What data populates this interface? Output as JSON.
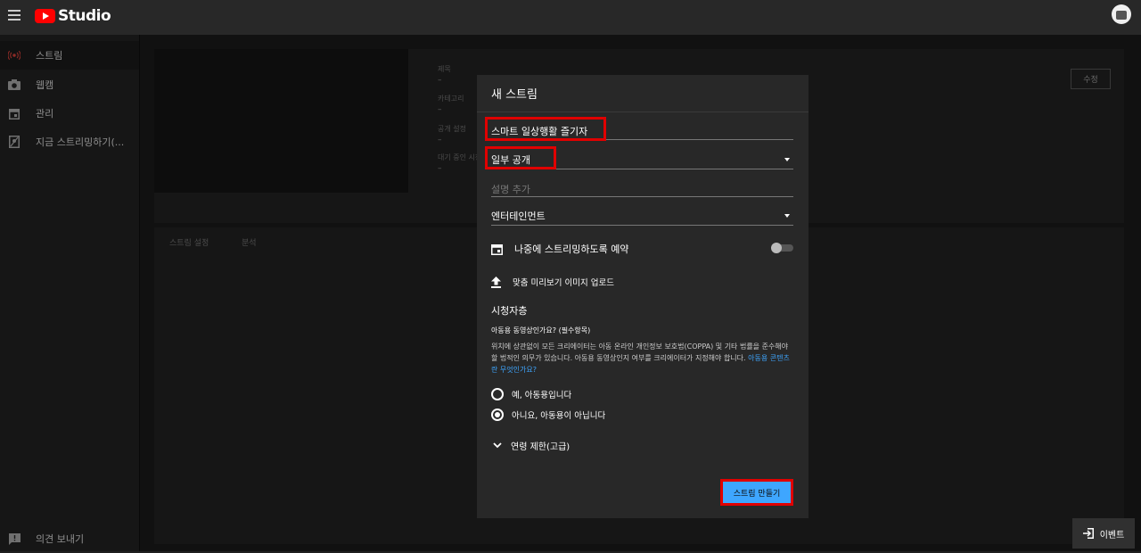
{
  "topbar": {
    "logo_text": "Studio",
    "menu_icon": "hamburger-menu-icon",
    "avatar_icon": "account-avatar-icon"
  },
  "sidebar": {
    "items": [
      {
        "label": "스트림",
        "icon": "live-stream-icon",
        "active": true
      },
      {
        "label": "웹캠",
        "icon": "camera-icon",
        "active": false
      },
      {
        "label": "관리",
        "icon": "calendar-icon",
        "active": false
      },
      {
        "label": "지금 스트리밍하기(...",
        "icon": "stream-now-icon",
        "active": false
      }
    ],
    "feedback_label": "의견 보내기",
    "feedback_icon": "feedback-icon"
  },
  "background": {
    "fields": [
      {
        "label": "제목",
        "value": "–"
      },
      {
        "label": "카테고리",
        "value": "–"
      },
      {
        "label": "공개 설정",
        "value": "–"
      },
      {
        "label": "대기 중인 시청자",
        "value": "–"
      }
    ],
    "edit_label": "수정",
    "tabs": [
      "스트림 설정",
      "분석"
    ]
  },
  "dialog": {
    "title": "새 스트림",
    "stream_title": "스마트 일상행활 즐기자",
    "visibility": "일부 공개",
    "description_placeholder": "설명 추가",
    "category": "엔터테인먼트",
    "schedule_label": "나중에 스트리밍하도록 예약",
    "schedule_enabled": false,
    "thumbnail_label": "맞춤 미리보기 이미지 업로드",
    "audience_title": "시청자층",
    "kids_question": "아동용 동영상인가요? (필수항목)",
    "kids_desc": "위치에 상관없이 모든 크리에이터는 아동 온라인 개인정보 보호법(COPPA) 및 기타 법률을 준수해야 할 법적인 의무가 있습니다. 아동용 동영상인지 여부를 크리에이터가 지정해야 합니다. ",
    "kids_link": "아동용 콘텐츠란 무엇인가요?",
    "option_yes": "예, 아동용입니다",
    "option_no": "아니요, 아동용이 아닙니다",
    "selected_option": "no",
    "age_restriction": "연령 제한(고급)",
    "create_label": "스트림 만들기"
  },
  "events_label": "이벤트"
}
